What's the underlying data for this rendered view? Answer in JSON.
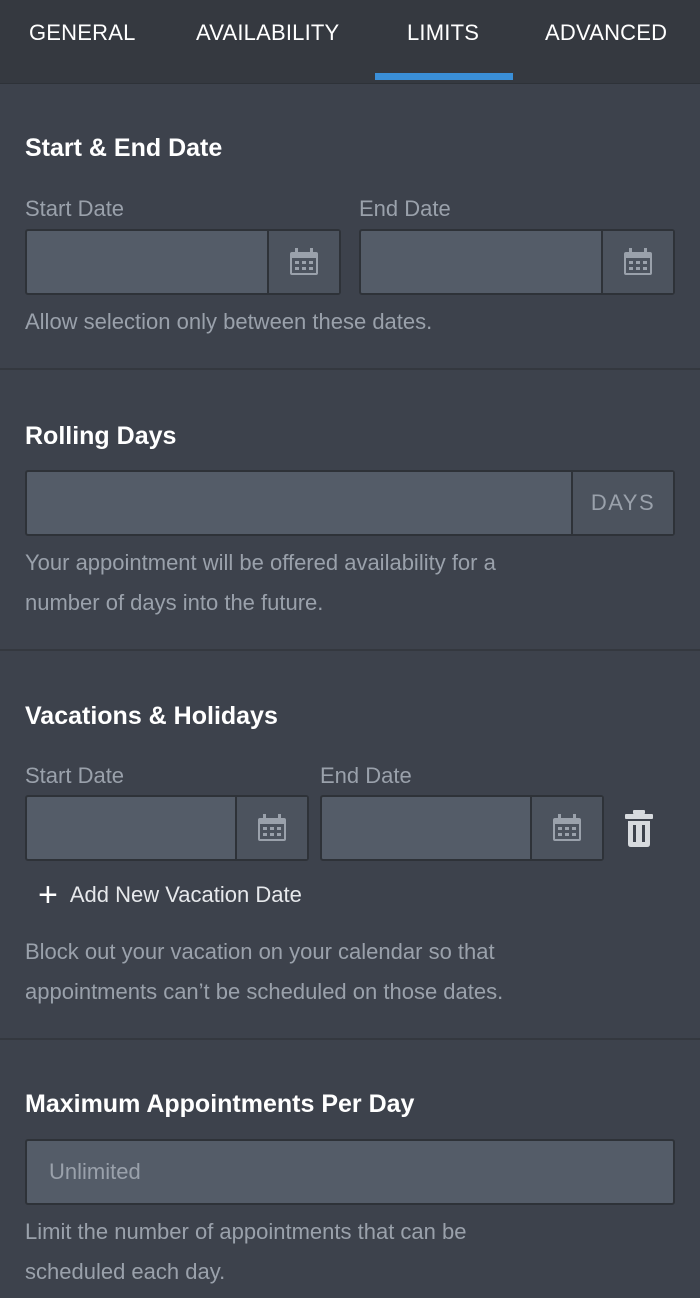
{
  "tabs": [
    {
      "label": "GENERAL"
    },
    {
      "label": "AVAILABILITY"
    },
    {
      "label": "LIMITS"
    },
    {
      "label": "ADVANCED"
    }
  ],
  "active_tab": "LIMITS",
  "start_end": {
    "title": "Start & End Date",
    "start_label": "Start Date",
    "end_label": "End Date",
    "start_value": "",
    "end_value": "",
    "help": "Allow selection only between these dates."
  },
  "rolling": {
    "title": "Rolling Days",
    "value": "",
    "suffix": "DAYS",
    "help_line1": "Your appointment will be offered availability for a",
    "help_line2": "number of days into the future."
  },
  "vacations": {
    "title": "Vacations & Holidays",
    "start_label": "Start Date",
    "end_label": "End Date",
    "start_value": "",
    "end_value": "",
    "add_icon": "+",
    "add_label": "Add New Vacation Date",
    "help_line1": "Block out your vacation on your calendar so that",
    "help_line2": "appointments can’t be scheduled on those dates."
  },
  "max_per_day": {
    "title": "Maximum Appointments Per Day",
    "placeholder": "Unlimited",
    "help_line1": "Limit the number of appointments that can be",
    "help_line2": "scheduled each day."
  },
  "icons": {
    "calendar": "calendar-icon",
    "trash": "trash-icon",
    "plus": "plus-icon"
  },
  "colors": {
    "accent": "#3a8fd8",
    "background": "#3d424c",
    "tabbar": "#353940",
    "input": "#545c68",
    "muted_text": "#9aa1ab"
  }
}
